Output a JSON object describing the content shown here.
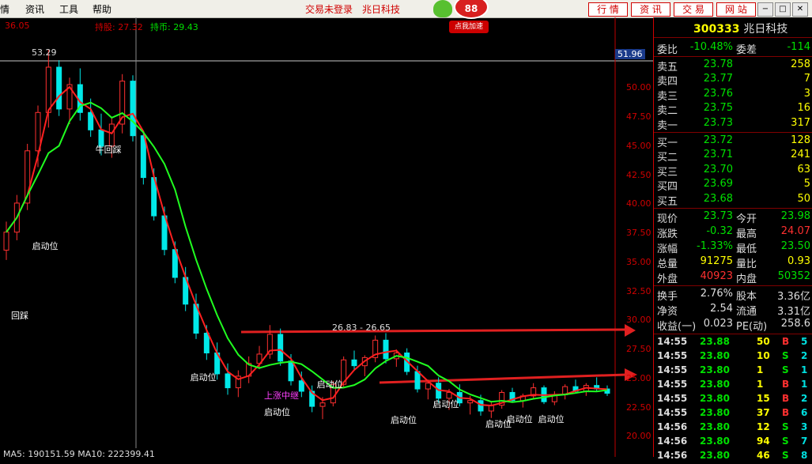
{
  "menubar": {
    "items": [
      "情",
      "资讯",
      "工具",
      "帮助"
    ],
    "status_login": "交易未登录",
    "stock_name": "兆日科技",
    "badge_count": "88",
    "badge_label": "点我加速",
    "tabs": [
      "行 情",
      "资 讯",
      "交 易",
      "网 站"
    ],
    "win_buttons": [
      "−",
      "□",
      "✕"
    ]
  },
  "chart_header": {
    "price_left": "36.05",
    "hold_cost": "持股: 27.32",
    "hold_city": "持币: 29.43",
    "current_line": "51.96",
    "high_label": "53.29"
  },
  "chart_data": {
    "type": "line",
    "title": "",
    "ylabel": "",
    "y_ticks": [
      "50.00",
      "47.50",
      "45.00",
      "42.50",
      "40.00",
      "37.50",
      "35.00",
      "32.50",
      "30.00",
      "27.50",
      "25.00",
      "22.50",
      "20.00"
    ],
    "ylim": [
      19.0,
      53.5
    ],
    "range_annotation": "26.83 - 26.65",
    "signals": [
      "启动位",
      "牛回踩",
      "启动位",
      "启动位",
      "启动位",
      "上涨中继",
      "启动位",
      "启动位",
      "启动位",
      "启动位",
      "回踩",
      "启动位"
    ],
    "footer": "MA5: 190151.59   MA10: 222399.41",
    "candles": [
      [
        36.05,
        38.5,
        35.2,
        37.6
      ],
      [
        37.6,
        40.8,
        36.9,
        40.1
      ],
      [
        40.1,
        45.2,
        39.5,
        44.6
      ],
      [
        44.6,
        48.5,
        43.2,
        47.9
      ],
      [
        47.9,
        53.29,
        46.6,
        51.8
      ],
      [
        51.8,
        52.4,
        47.6,
        48.2
      ],
      [
        48.2,
        50.9,
        46.9,
        50.3
      ],
      [
        50.3,
        51.7,
        47.2,
        47.9
      ],
      [
        47.9,
        49.1,
        45.8,
        46.4
      ],
      [
        46.4,
        47.8,
        44.2,
        45.0
      ],
      [
        45.0,
        47.4,
        44.0,
        46.9
      ],
      [
        46.9,
        51.2,
        46.1,
        50.6
      ],
      [
        50.6,
        51.1,
        45.4,
        45.9
      ],
      [
        45.9,
        46.2,
        41.7,
        42.3
      ],
      [
        42.3,
        43.1,
        38.6,
        39.0
      ],
      [
        39.0,
        39.8,
        35.6,
        36.1
      ],
      [
        36.1,
        36.8,
        33.2,
        33.7
      ],
      [
        33.7,
        34.6,
        30.8,
        31.4
      ],
      [
        31.4,
        32.3,
        28.4,
        28.9
      ],
      [
        28.9,
        29.6,
        26.6,
        27.2
      ],
      [
        27.2,
        28.1,
        24.9,
        25.4
      ],
      [
        25.4,
        26.3,
        23.6,
        24.2
      ],
      [
        24.2,
        25.7,
        23.4,
        25.2
      ],
      [
        25.2,
        26.9,
        24.6,
        26.3
      ],
      [
        26.3,
        27.8,
        25.8,
        27.1
      ],
      [
        27.1,
        29.6,
        26.7,
        28.8
      ],
      [
        28.8,
        29.3,
        26.1,
        26.5
      ],
      [
        26.5,
        27.1,
        24.4,
        24.8
      ],
      [
        24.8,
        25.6,
        23.4,
        23.9
      ],
      [
        23.9,
        24.4,
        22.1,
        22.6
      ],
      [
        22.6,
        23.4,
        21.5,
        22.9
      ],
      [
        22.9,
        24.8,
        22.6,
        24.5
      ],
      [
        24.5,
        26.9,
        24.2,
        26.6
      ],
      [
        26.6,
        27.4,
        25.7,
        26.1
      ],
      [
        26.1,
        27.0,
        25.2,
        26.8
      ],
      [
        26.8,
        28.7,
        26.4,
        28.3
      ],
      [
        28.3,
        28.9,
        26.3,
        26.7
      ],
      [
        26.7,
        27.5,
        26.0,
        27.2
      ],
      [
        27.2,
        27.6,
        25.3,
        25.6
      ],
      [
        25.6,
        26.1,
        23.8,
        24.1
      ],
      [
        24.1,
        24.9,
        23.2,
        24.6
      ],
      [
        24.6,
        25.1,
        22.9,
        23.3
      ],
      [
        23.3,
        24.1,
        22.3,
        23.8
      ],
      [
        23.8,
        24.5,
        22.6,
        22.9
      ],
      [
        22.9,
        23.5,
        21.9,
        23.1
      ],
      [
        23.1,
        23.6,
        21.8,
        22.2
      ],
      [
        22.2,
        23.0,
        21.6,
        22.7
      ],
      [
        22.7,
        24.0,
        22.4,
        23.8
      ],
      [
        23.8,
        24.2,
        22.9,
        23.1
      ],
      [
        23.1,
        23.7,
        22.5,
        23.5
      ],
      [
        23.5,
        24.6,
        23.2,
        24.2
      ],
      [
        24.2,
        24.4,
        22.8,
        23.0
      ],
      [
        23.0,
        23.9,
        22.7,
        23.6
      ],
      [
        23.6,
        24.5,
        23.2,
        24.3
      ],
      [
        24.3,
        24.9,
        23.7,
        23.9
      ],
      [
        23.9,
        24.6,
        23.5,
        24.4
      ],
      [
        24.4,
        25.1,
        23.9,
        24.1
      ],
      [
        24.1,
        24.4,
        23.5,
        23.73
      ]
    ]
  },
  "quote": {
    "code": "300333",
    "name": "兆日科技",
    "weibi_label": "委比",
    "weibi_value": "-10.48%",
    "weicha_label": "委差",
    "weicha_value": "-114",
    "sell": [
      {
        "label": "卖五",
        "price": "23.78",
        "vol": "258"
      },
      {
        "label": "卖四",
        "price": "23.77",
        "vol": "7"
      },
      {
        "label": "卖三",
        "price": "23.76",
        "vol": "3"
      },
      {
        "label": "卖二",
        "price": "23.75",
        "vol": "16"
      },
      {
        "label": "卖一",
        "price": "23.73",
        "vol": "317"
      }
    ],
    "buy": [
      {
        "label": "买一",
        "price": "23.72",
        "vol": "128"
      },
      {
        "label": "买二",
        "price": "23.71",
        "vol": "241"
      },
      {
        "label": "买三",
        "price": "23.70",
        "vol": "63"
      },
      {
        "label": "买四",
        "price": "23.69",
        "vol": "5"
      },
      {
        "label": "买五",
        "price": "23.68",
        "vol": "50"
      }
    ],
    "stats": [
      {
        "l1": "现价",
        "v1": "23.73",
        "l2": "今开",
        "v2": "23.98",
        "c1": "#00e000",
        "c2": "#00e000"
      },
      {
        "l1": "涨跌",
        "v1": "-0.32",
        "l2": "最高",
        "v2": "24.07",
        "c1": "#00e000",
        "c2": "#ff3030"
      },
      {
        "l1": "涨幅",
        "v1": "-1.33%",
        "l2": "最低",
        "v2": "23.50",
        "c1": "#00e000",
        "c2": "#00e000"
      },
      {
        "l1": "总量",
        "v1": "91275",
        "l2": "量比",
        "v2": "0.93",
        "c1": "#ffff00",
        "c2": "#ffff00"
      },
      {
        "l1": "外盘",
        "v1": "40923",
        "l2": "内盘",
        "v2": "50352",
        "c1": "#ff3030",
        "c2": "#00e000"
      }
    ],
    "fin": [
      {
        "l1": "换手",
        "v1": "2.76%",
        "l2": "股本",
        "v2": "3.36亿"
      },
      {
        "l1": "净资",
        "v1": "2.54",
        "l2": "流通",
        "v2": "3.31亿"
      },
      {
        "l1": "收益(一)",
        "v1": "0.023",
        "l2": "PE(动)",
        "v2": "258.6"
      }
    ],
    "ticks": [
      {
        "t": "14:55",
        "p": "23.88",
        "v": "50",
        "d": "B",
        "n": "5"
      },
      {
        "t": "14:55",
        "p": "23.80",
        "v": "10",
        "d": "S",
        "n": "2"
      },
      {
        "t": "14:55",
        "p": "23.80",
        "v": "1",
        "d": "S",
        "n": "1"
      },
      {
        "t": "14:55",
        "p": "23.80",
        "v": "1",
        "d": "B",
        "n": "1"
      },
      {
        "t": "14:55",
        "p": "23.80",
        "v": "15",
        "d": "B",
        "n": "2"
      },
      {
        "t": "14:55",
        "p": "23.80",
        "v": "37",
        "d": "B",
        "n": "6"
      },
      {
        "t": "14:56",
        "p": "23.80",
        "v": "12",
        "d": "S",
        "n": "3"
      },
      {
        "t": "14:56",
        "p": "23.80",
        "v": "94",
        "d": "S",
        "n": "7"
      },
      {
        "t": "14:56",
        "p": "23.80",
        "v": "46",
        "d": "S",
        "n": "8"
      }
    ]
  }
}
